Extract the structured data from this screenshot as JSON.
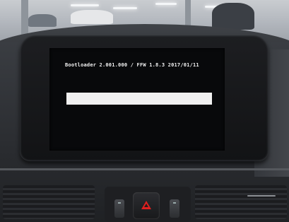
{
  "screen": {
    "boot_message": "Bootloader 2.001.000 / FFW 1.8.3 2017/01/11",
    "progress_percent": 100
  },
  "colors": {
    "screen_background": "#08090b",
    "screen_text": "#f2f2f2",
    "progress_fill": "#f0f0f0",
    "hazard_red": "#e02020"
  },
  "icons": [
    "hazard-warning-icon"
  ]
}
